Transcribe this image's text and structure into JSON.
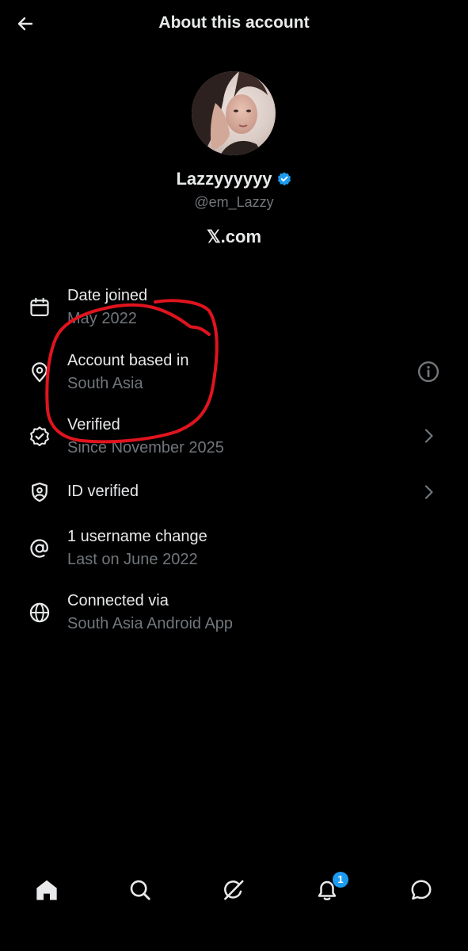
{
  "header": {
    "title": "About this account",
    "back_icon": "arrow-left-icon"
  },
  "profile": {
    "display_name": "Lazzyyyyyy",
    "handle": "@em_Lazzy",
    "verified": true,
    "verified_color": "#1d9bf0",
    "domain": "𝕏.com"
  },
  "rows": [
    {
      "icon": "calendar-icon",
      "label": "Date joined",
      "value": "May 2022",
      "trailing": ""
    },
    {
      "icon": "location-pin-icon",
      "label": "Account based in",
      "value": "South Asia",
      "trailing": "info-icon"
    },
    {
      "icon": "verified-badge-icon",
      "label": "Verified",
      "value": "Since November 2025",
      "trailing": "chevron-right-icon"
    },
    {
      "icon": "id-shield-icon",
      "label": "ID verified",
      "value": "",
      "trailing": "chevron-right-icon"
    },
    {
      "icon": "at-sign-icon",
      "label": "1 username change",
      "value": "Last on June 2022",
      "trailing": ""
    },
    {
      "icon": "globe-icon",
      "label": "Connected via",
      "value": "South Asia Android App",
      "trailing": ""
    }
  ],
  "bottom_nav": {
    "items": [
      "home-icon",
      "search-icon",
      "grok-icon",
      "notifications-icon",
      "messages-icon"
    ],
    "notifications_badge": "1"
  },
  "colors": {
    "background": "#000000",
    "primary_text": "#e7e9ea",
    "secondary_text": "#71767b",
    "accent": "#1d9bf0",
    "annotation": "#e0141e"
  }
}
